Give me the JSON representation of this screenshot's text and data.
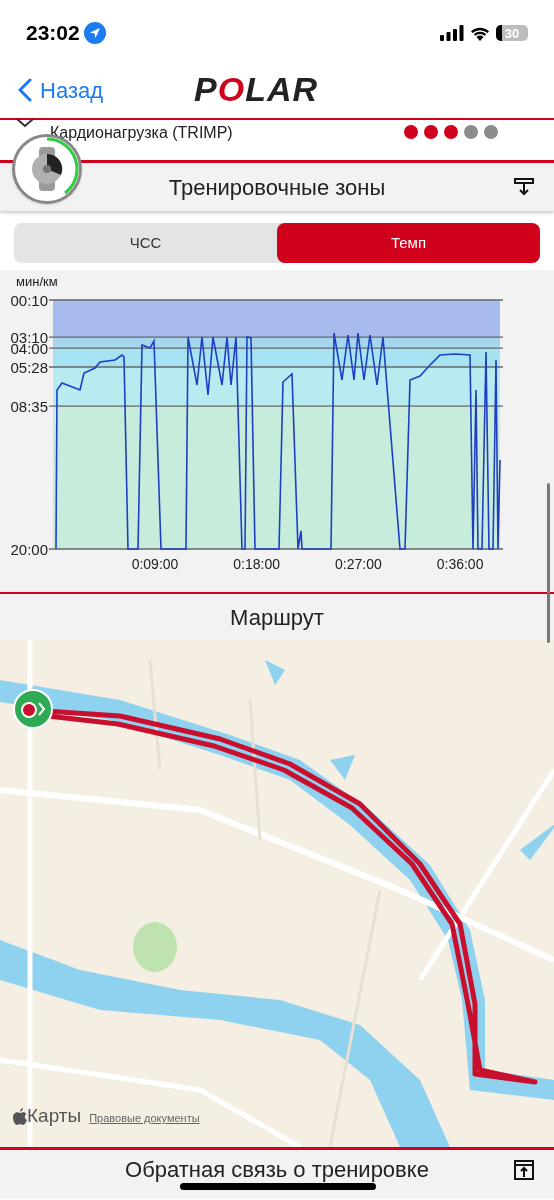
{
  "status_bar": {
    "time": "23:02",
    "battery": "30"
  },
  "nav": {
    "back": "Назад",
    "logo": "POLAR"
  },
  "trimp": {
    "label": "Кардионагрузка (TRIMP)",
    "stars": 3
  },
  "zones": {
    "title": "Тренировочные зоны",
    "tabs": [
      {
        "label": "ЧСС",
        "selected": false
      },
      {
        "label": "Темп",
        "selected": true
      }
    ],
    "chart": {
      "unit": "мин/км",
      "y_labels": [
        "00:10",
        "03:10",
        "04:00",
        "05:28",
        "08:35",
        "20:00"
      ],
      "x_labels": [
        "0:09:00",
        "0:18:00",
        "0:27:00",
        "0:36:00"
      ]
    }
  },
  "route": {
    "title": "Маршрут",
    "maps_label": "Карты",
    "legal_link": "Правовые документы"
  },
  "feedback": {
    "title": "Обратная связь о тренировке"
  }
}
